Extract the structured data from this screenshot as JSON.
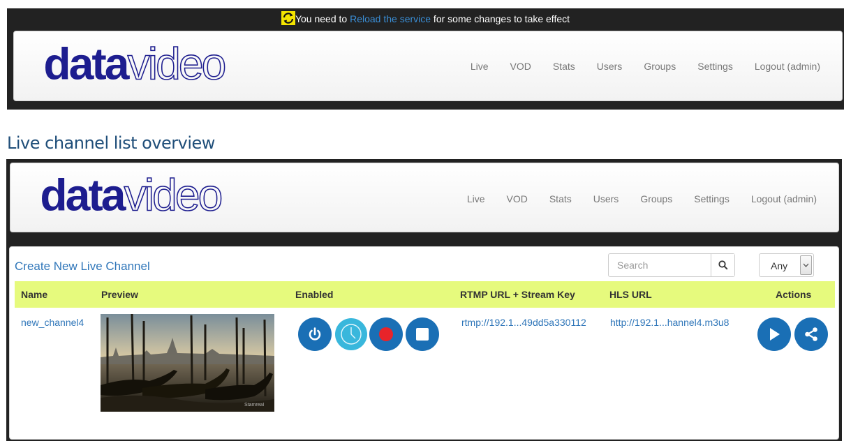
{
  "notice": {
    "prefix": "You need to ",
    "link": "Reload the service",
    "suffix": " for some changes to take effect"
  },
  "nav": {
    "brand_bold": "data",
    "brand_light": "video",
    "links": [
      "Live",
      "VOD",
      "Stats",
      "Users",
      "Groups",
      "Settings",
      "Logout (admin)"
    ]
  },
  "section_title": "Live channel list overview",
  "panel": {
    "create_label": "Create New Live Channel",
    "search_placeholder": "Search",
    "filter_value": "Any",
    "columns": [
      "Name",
      "Preview",
      "Enabled",
      "RTMP URL + Stream Key",
      "HLS URL",
      "Actions"
    ]
  },
  "rows": [
    {
      "name": "new_channel4",
      "rtmp": "rtmp://192.1...49dd5a330112",
      "hls": "http://192.1...hannel4.m3u8",
      "watermark": "Stamreal"
    }
  ],
  "colors": {
    "accent_blue": "#1a6fb5",
    "link_blue": "#2f76b9",
    "brand_navy": "#1d1d8f",
    "header_row": "#e6fa7d",
    "record_red": "#e8242a",
    "schedule_teal": "#39b7dc",
    "notice_icon_yellow": "#f4e400"
  },
  "icons": {
    "notice": "reload-icon",
    "search": "search-icon",
    "dropdown": "chevron-down-icon",
    "enable": "power-icon",
    "schedule": "clock-icon",
    "record": "record-icon",
    "stop": "stop-icon",
    "play": "play-icon",
    "share": "share-icon"
  }
}
